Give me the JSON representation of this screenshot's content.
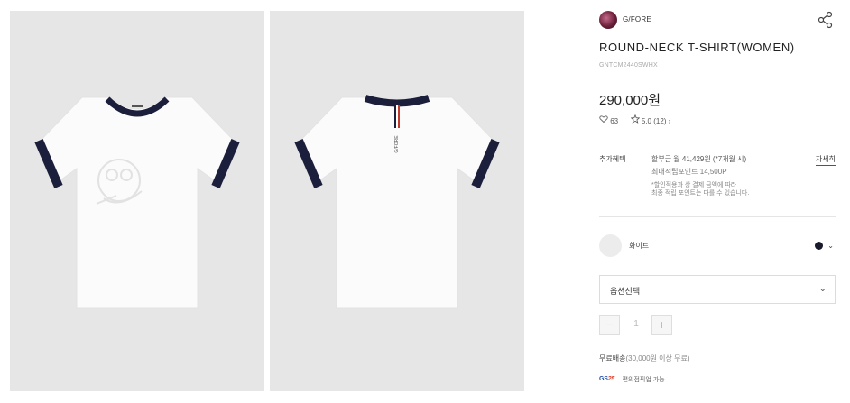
{
  "gallery": {
    "front_alt": "front view of white t-shirt with navy trim",
    "back_alt": "back view of white t-shirt with navy trim",
    "back_tag_text": "G/FORE"
  },
  "product": {
    "brand": "G/FORE",
    "title": "ROUND-NECK T-SHIRT(WOMEN)",
    "sku": "GNTCM2440SWHX",
    "price": "290,000원",
    "likes": "63",
    "rating": "5.0",
    "review_count": "(12)",
    "review_chevron": "›"
  },
  "benefits": {
    "label": "추가혜택",
    "line1": "할부금 월 41,429원 (*7개월 시)",
    "line2": "최대적립포인트 14,500P",
    "note1": "*할인적용과 상 결제 금액에 따라",
    "note2": "최종 적립 포인트는 다를 수 있습니다.",
    "detail_link": "자세히"
  },
  "color_option": {
    "label": "화이트",
    "dot_color": "#1a1a2e",
    "chevron": "⌄"
  },
  "option_select": {
    "label": "옵션선택",
    "chevron": "⌄"
  },
  "quantity": {
    "minus": "−",
    "value": "1",
    "plus": "+"
  },
  "shipping": {
    "main": "무료배송",
    "condition": "(30,000원 이상 무료)"
  },
  "gs": {
    "logo_text": "GS",
    "logo_num": "25",
    "text": "편의점픽업 가능"
  },
  "icons": {
    "share": "share-icon",
    "like": "heart-icon",
    "star": "star-icon"
  },
  "colors": {
    "shirt_body": "#fbfbfb",
    "shirt_trim": "#1b1f3b",
    "photo_bg": "#e6e6e6"
  }
}
